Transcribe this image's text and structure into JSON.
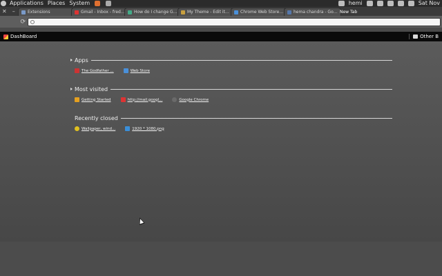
{
  "panel": {
    "menus": [
      "Applications",
      "Places",
      "System"
    ],
    "user": "hemi",
    "clock": "Sat Nov"
  },
  "tabs": [
    {
      "title": "Extensions",
      "color": "#7a9ac8"
    },
    {
      "title": "Gmail - Inbox - fredis...",
      "color": "#d33"
    },
    {
      "title": "How do I change Go...",
      "color": "#4a8"
    },
    {
      "title": "My Theme - Edit item",
      "color": "#c8a040"
    },
    {
      "title": "Chrome Web Store - ...",
      "color": "#4a90d9"
    },
    {
      "title": "hema chandra - Goo...",
      "color": "#57a"
    },
    {
      "title": "New Tab",
      "color": "#888"
    }
  ],
  "omnibox": {
    "value": ""
  },
  "bookmarks": {
    "dashboard": "DashBoard",
    "other": "Other B"
  },
  "sections": {
    "apps": {
      "title": "Apps",
      "items": [
        {
          "label": "The Godfather ...",
          "color": "#c33"
        },
        {
          "label": "Web Store",
          "color": "#4a90d9"
        }
      ]
    },
    "most_visited": {
      "title": "Most visited",
      "items": [
        {
          "label": "Getting Started",
          "color": "#e5a020"
        },
        {
          "label": "http://mail.googl...",
          "color": "#d33"
        },
        {
          "label": "Google Chrome",
          "color": "#6a6a6a"
        }
      ]
    },
    "recently_closed": {
      "title": "Recently closed",
      "items": [
        {
          "label": "Wallpaper, wind...",
          "color": "#e0c020"
        },
        {
          "label": "1920 * 1080.png",
          "color": "#3a8fd9"
        }
      ]
    }
  }
}
